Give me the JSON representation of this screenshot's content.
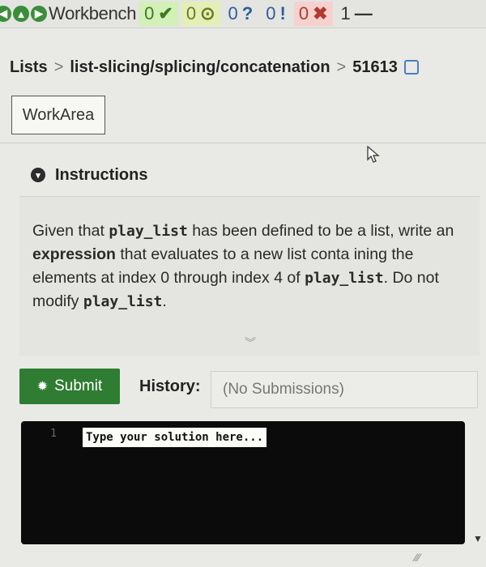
{
  "topbar": {
    "app_title": "Workbench",
    "counters": [
      {
        "value": "0",
        "symbol": "✔",
        "status": "passed"
      },
      {
        "value": "0",
        "symbol": "⊙",
        "status": "pending"
      },
      {
        "value": "0",
        "symbol": "?",
        "status": "unknown"
      },
      {
        "value": "0",
        "symbol": "!",
        "status": "warning"
      },
      {
        "value": "0",
        "symbol": "✖",
        "status": "failed"
      },
      {
        "value": "1",
        "symbol": "—",
        "status": "total"
      }
    ]
  },
  "breadcrumb": {
    "root": "Lists",
    "path": "list-slicing/splicing/concatenation",
    "exercise_id": "51613"
  },
  "tabs": {
    "work_area": "WorkArea"
  },
  "instructions": {
    "heading": "Instructions",
    "p1": "Given that ",
    "code1": "play_list",
    "p2": " has been defined to be a list, write an ",
    "bold1": "expression",
    "p3": " that evaluates to a new list conta ining the elements at index 0 through index 4 of ",
    "code2": "play_list",
    "p4": ". Do not modify ",
    "code3": "play_list",
    "p5": "."
  },
  "submit": {
    "label": "Submit"
  },
  "history": {
    "label": "History:",
    "value": "(No Submissions)"
  },
  "editor": {
    "line_number": "1",
    "placeholder": "Type your solution here..."
  },
  "colors": {
    "submit_green": "#2f7d32",
    "editor_bg": "#0b0b0b",
    "counter_ok_bg": "#d2f0b8",
    "counter_err_bg": "#f6d2cf"
  }
}
